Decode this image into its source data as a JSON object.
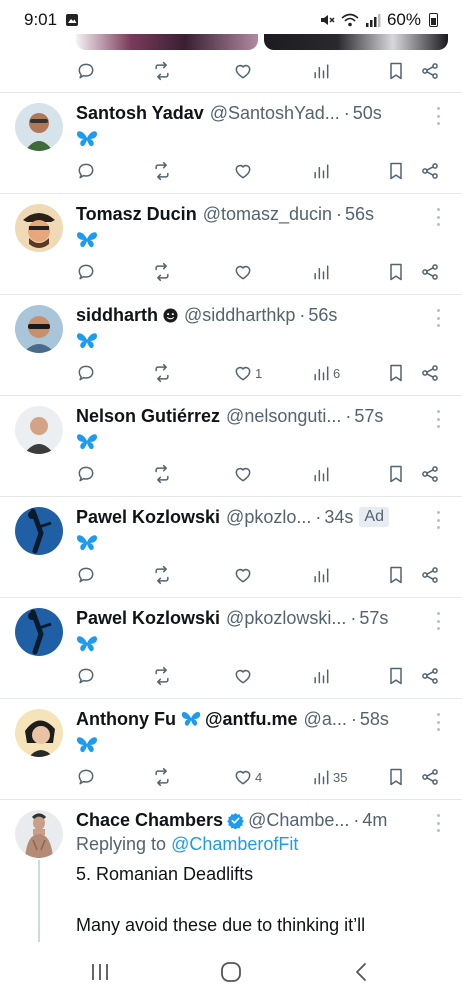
{
  "status_bar": {
    "time": "9:01",
    "battery": "60%",
    "icons": [
      "gallery-icon",
      "mute-icon",
      "wifi-icon",
      "signal-icon",
      "battery-icon"
    ]
  },
  "top_tweet_actions": {
    "like_count": "",
    "view_count": ""
  },
  "tweets": [
    {
      "name": "Santosh Yadav",
      "handle": "@SantoshYad...",
      "sep": "·",
      "time": "50s",
      "content": "🦋",
      "reply_count": "",
      "retweet_count": "",
      "like_count": "",
      "view_count": ""
    },
    {
      "name": "Tomasz Ducin",
      "handle": "@tomasz_ducin",
      "sep": "·",
      "time": "56s",
      "content": "🦋",
      "reply_count": "",
      "retweet_count": "",
      "like_count": "",
      "view_count": ""
    },
    {
      "name": "siddharth",
      "handle": "@siddharthkp",
      "sep": "·",
      "time": "56s",
      "content": "🦋",
      "reply_count": "",
      "retweet_count": "",
      "like_count": "1",
      "view_count": "6"
    },
    {
      "name": "Nelson Gutiérrez",
      "handle": "@nelsonguti...",
      "sep": "·",
      "time": "57s",
      "content": "🦋",
      "reply_count": "",
      "retweet_count": "",
      "like_count": "",
      "view_count": ""
    },
    {
      "name": "Pawel Kozlowski",
      "handle": "@pkozlo...",
      "sep": "·",
      "time": "34s",
      "ad": "Ad",
      "content": "🦋",
      "reply_count": "",
      "retweet_count": "",
      "like_count": "",
      "view_count": ""
    },
    {
      "name": "Pawel Kozlowski",
      "handle": "@pkozlowski...",
      "sep": "·",
      "time": "57s",
      "content": "🦋",
      "reply_count": "",
      "retweet_count": "",
      "like_count": "",
      "view_count": ""
    },
    {
      "name": "Anthony Fu",
      "name_suffix": "@antfu.me",
      "handle": "@a...",
      "sep": "·",
      "time": "58s",
      "content": "🦋",
      "reply_count": "",
      "retweet_count": "",
      "like_count": "4",
      "view_count": "35"
    }
  ],
  "last_tweet": {
    "name": "Chace Chambers",
    "handle": "@Chambe...",
    "sep": "·",
    "time": "4m",
    "replying_label": "Replying to",
    "replying_handle": "@ChamberofFit",
    "lines": [
      "5. Romanian Deadlifts",
      "",
      "Many avoid these due to thinking it’ll"
    ]
  },
  "nav": {
    "buttons": [
      "recents-button",
      "home-button",
      "back-button"
    ]
  },
  "colors": {
    "accent": "#1d9bf0",
    "text": "#0f1419",
    "muted": "#536471",
    "divider": "#e6e9eb"
  }
}
